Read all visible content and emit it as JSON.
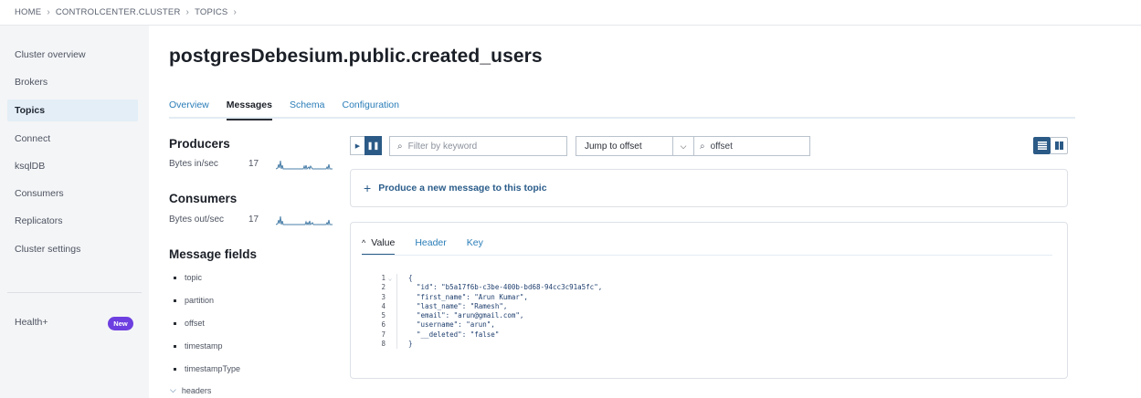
{
  "breadcrumb": [
    "HOME",
    "CONTROLCENTER.CLUSTER",
    "TOPICS"
  ],
  "sidebar": {
    "items": [
      {
        "label": "Cluster overview",
        "active": false
      },
      {
        "label": "Brokers",
        "active": false
      },
      {
        "label": "Topics",
        "active": true
      },
      {
        "label": "Connect",
        "active": false
      },
      {
        "label": "ksqlDB",
        "active": false
      },
      {
        "label": "Consumers",
        "active": false
      },
      {
        "label": "Replicators",
        "active": false
      },
      {
        "label": "Cluster settings",
        "active": false
      }
    ],
    "health_label": "Health+",
    "new_badge": "New"
  },
  "page": {
    "title": "postgresDebesium.public.created_users",
    "tabs": [
      "Overview",
      "Messages",
      "Schema",
      "Configuration"
    ],
    "active_tab": "Messages"
  },
  "stats": {
    "producers_title": "Producers",
    "bytes_in_label": "Bytes in/sec",
    "bytes_in_value": "17",
    "consumers_title": "Consumers",
    "bytes_out_label": "Bytes out/sec",
    "bytes_out_value": "17"
  },
  "message_fields": {
    "title": "Message fields",
    "fields": [
      "topic",
      "partition",
      "offset",
      "timestamp",
      "timestampType"
    ],
    "expandable": "headers"
  },
  "toolbar": {
    "search_placeholder": "Filter by keyword",
    "jump_select": "Jump to offset",
    "offset_placeholder": "offset"
  },
  "produce": {
    "label": "Produce a new message to this topic"
  },
  "message": {
    "tabs": [
      "Value",
      "Header",
      "Key"
    ],
    "active_tab": "Value",
    "code_lines": [
      "{",
      "  \"id\": \"b5a17f6b-c3be-400b-bd68-94cc3c91a5fc\",",
      "  \"first_name\": \"Arun Kumar\",",
      "  \"last_name\": \"Ramesh\",",
      "  \"email\": \"arun@gmail.com\",",
      "  \"username\": \"arun\",",
      "  \"__deleted\": \"false\"",
      "}"
    ]
  },
  "colors": {
    "accent": "#2b5a86",
    "link": "#2a7db8",
    "badge": "#6d3fe0",
    "sidebar_bg": "#f4f5f7",
    "active_item_bg": "#e3eef6"
  }
}
